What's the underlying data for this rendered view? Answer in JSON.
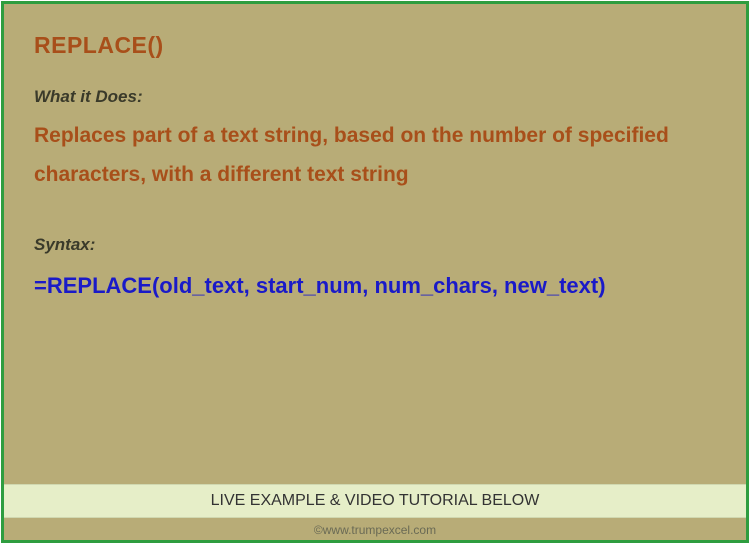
{
  "title": "REPLACE()",
  "what_it_does_label": "What it Does:",
  "description": "Replaces part of a text string, based on the number of specified characters, with a different text string",
  "syntax_label": "Syntax:",
  "syntax_text": "=REPLACE(old_text, start_num, num_chars, new_text)",
  "footer": "LIVE EXAMPLE & VIDEO TUTORIAL BELOW",
  "watermark": "©www.trumpexcel.com"
}
